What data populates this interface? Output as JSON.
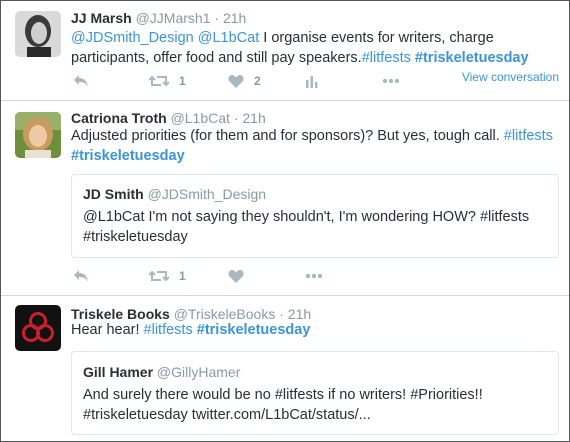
{
  "colors": {
    "link": "#3b94d9",
    "muted": "#8899a6",
    "icon": "#aab8c2",
    "logo_bg": "#111111",
    "logo_ring": "#cc1f2d"
  },
  "tweets": [
    {
      "name": "JJ Marsh",
      "handle": "@JJMarsh1",
      "dot": "·",
      "time": "21h",
      "body": {
        "mention1": "@JDSmith_Design",
        "mention2": "@L1bCat",
        "text1": " I organise events for writers, charge",
        "text2": "participants, offer food and still pay speakers.",
        "tag1": "#litfests",
        "tag2": "#triskeletuesday"
      },
      "retweets": "1",
      "likes": "2",
      "view_conversation": "View conversation"
    },
    {
      "name": "Catriona Troth",
      "handle": "@L1bCat",
      "dot": "·",
      "time": "21h",
      "body": {
        "text1": "Adjusted priorities (for them and for sponsors)? But yes, tough call.",
        "tag1": "#litfests",
        "tag2": "#triskeletuesday"
      },
      "quote": {
        "name": "JD Smith",
        "handle": "@JDSmith_Design",
        "line1": "@L1bCat I'm not saying they shouldn't, I'm wondering HOW? #litfests",
        "line2": "#triskeletuesday"
      },
      "retweets": "1"
    },
    {
      "name": "Triskele Books",
      "handle": "@TriskeleBooks",
      "dot": "·",
      "time": "21h",
      "body": {
        "text1": "Hear hear!",
        "tag1": "#litfests",
        "tag2": "#triskeletuesday"
      },
      "quote": {
        "name": "Gill Hamer",
        "handle": "@GillyHamer",
        "line1": "And surely there would be no #litfests if no writers! #Priorities!!",
        "line2": "#triskeletuesday  twitter.com/L1bCat/status/..."
      }
    }
  ]
}
